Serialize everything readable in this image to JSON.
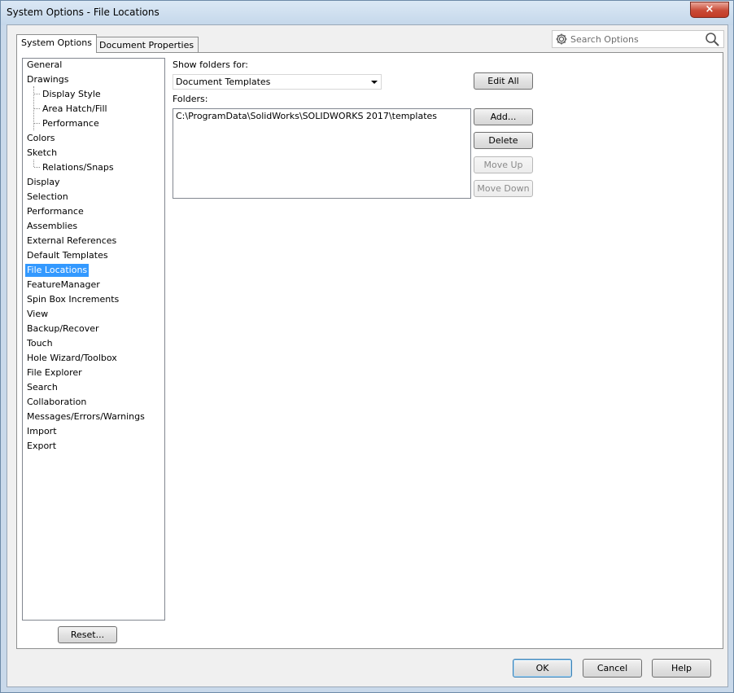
{
  "window": {
    "title": "System Options - File Locations",
    "close_label": "×"
  },
  "tabs": [
    {
      "label": "System Options",
      "active": true
    },
    {
      "label": "Document Properties",
      "active": false
    }
  ],
  "search": {
    "placeholder": "Search Options"
  },
  "tree": {
    "items": [
      {
        "label": "General"
      },
      {
        "label": "Drawings"
      },
      {
        "label": "Display Style",
        "child": true
      },
      {
        "label": "Area Hatch/Fill",
        "child": true
      },
      {
        "label": "Performance",
        "child": true
      },
      {
        "label": "Colors"
      },
      {
        "label": "Sketch"
      },
      {
        "label": "Relations/Snaps",
        "child": true
      },
      {
        "label": "Display"
      },
      {
        "label": "Selection"
      },
      {
        "label": "Performance"
      },
      {
        "label": "Assemblies"
      },
      {
        "label": "External References"
      },
      {
        "label": "Default Templates"
      },
      {
        "label": "File Locations",
        "selected": true
      },
      {
        "label": "FeatureManager"
      },
      {
        "label": "Spin Box Increments"
      },
      {
        "label": "View"
      },
      {
        "label": "Backup/Recover"
      },
      {
        "label": "Touch"
      },
      {
        "label": "Hole Wizard/Toolbox"
      },
      {
        "label": "File Explorer"
      },
      {
        "label": "Search"
      },
      {
        "label": "Collaboration"
      },
      {
        "label": "Messages/Errors/Warnings"
      },
      {
        "label": "Import"
      },
      {
        "label": "Export"
      }
    ],
    "reset_label": "Reset..."
  },
  "file_locations": {
    "show_folders_label": "Show folders for:",
    "show_folders_value": "Document Templates",
    "folders_label": "Folders:",
    "folders": [
      "C:\\ProgramData\\SolidWorks\\SOLIDWORKS 2017\\templates"
    ],
    "edit_all_label": "Edit All",
    "add_label": "Add...",
    "delete_label": "Delete",
    "move_up_label": "Move Up",
    "move_down_label": "Move Down"
  },
  "footer": {
    "ok_label": "OK",
    "cancel_label": "Cancel",
    "help_label": "Help"
  }
}
